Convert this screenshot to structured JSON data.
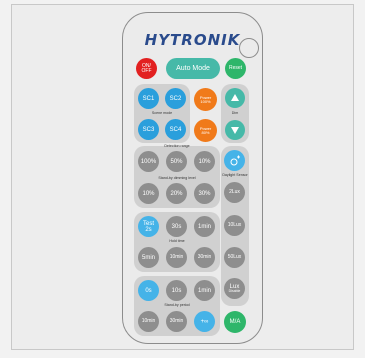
{
  "brand": "HYTRONIK",
  "brand_mark": "®",
  "top": {
    "on_off": "ON/\nOFF",
    "auto_mode": "Auto Mode",
    "reset": "Reset"
  },
  "scenes": {
    "sc1": "SC1",
    "sc2": "SC2",
    "sc3": "SC3",
    "sc4": "SC4",
    "label": "Scene mode"
  },
  "power": {
    "p100": "Power\n100%",
    "p80": "Power\n80%"
  },
  "dim": {
    "label": "Dim"
  },
  "detection": {
    "label": "Detection range",
    "values": [
      "100%",
      "50%",
      "10%"
    ]
  },
  "standby_dim": {
    "label": "Stand-by dimming level",
    "values": [
      "10%",
      "20%",
      "30%"
    ]
  },
  "daylight": {
    "label": "Daylight Sensor"
  },
  "lux": {
    "values": [
      "2Lux",
      "10Lux",
      "50Lux"
    ],
    "disable_main": "Lux",
    "disable_sub": "Disable"
  },
  "hold": {
    "test": "Test\n2s",
    "values": [
      "30s",
      "1min",
      "5min",
      "10min",
      "30min"
    ],
    "label": "Hold time"
  },
  "standby_period": {
    "values": [
      "0s",
      "10s",
      "1min",
      "10min",
      "30min",
      "+∞"
    ],
    "label": "Stand-by period"
  },
  "ma": "M/A",
  "colors": {
    "gray": "#8e8e8e",
    "blue": "#2a9fdc",
    "orange": "#f07a1a",
    "green": "#2eb66a",
    "teal": "#46b9a8",
    "red": "#e22020",
    "brand": "#2a4b8c"
  }
}
